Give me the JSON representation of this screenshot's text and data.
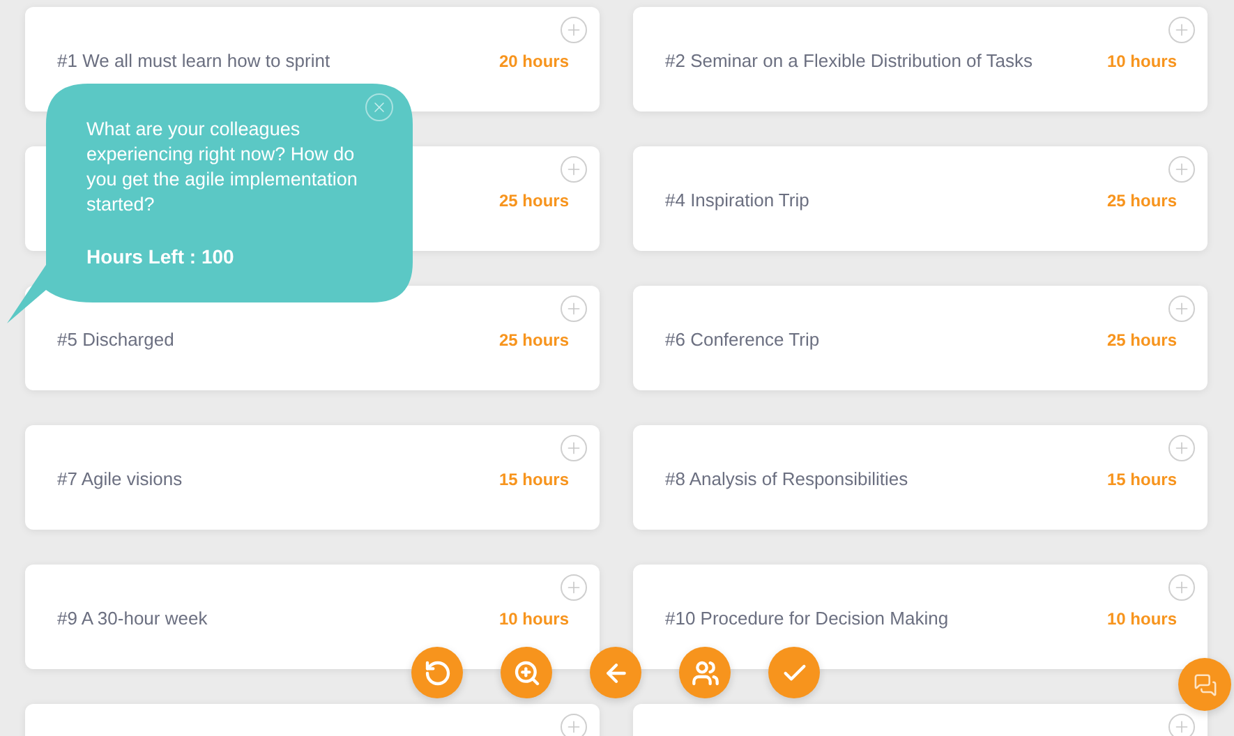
{
  "cards": [
    {
      "kind": "full",
      "title": "#1 We all must learn how to sprint",
      "hours": "20 hours"
    },
    {
      "kind": "full",
      "title": "#2 Seminar on a Flexible Distribution of Tasks",
      "hours": "10 hours"
    },
    {
      "kind": "full",
      "hours": "25 hours"
    },
    {
      "kind": "full",
      "title": "#4 Inspiration Trip",
      "hours": "25 hours"
    },
    {
      "kind": "full",
      "title": "#5 Discharged",
      "hours": "25 hours"
    },
    {
      "kind": "full",
      "title": "#6 Conference Trip",
      "hours": "25 hours"
    },
    {
      "kind": "full",
      "title": "#7 Agile visions",
      "hours": "15 hours"
    },
    {
      "kind": "full",
      "title": "#8 Analysis of Responsibilities",
      "hours": "15 hours"
    },
    {
      "kind": "full",
      "title": "#9 A 30-hour week",
      "hours": "10 hours"
    },
    {
      "kind": "full",
      "title": "#10 Procedure for Decision Making",
      "hours": "10 hours"
    },
    {
      "kind": "partial"
    },
    {
      "kind": "partial"
    }
  ],
  "tooltip": {
    "question": "What are your colleagues experiencing right now? How do you get the agile implementation started?",
    "hours_left": "Hours Left : 100"
  }
}
